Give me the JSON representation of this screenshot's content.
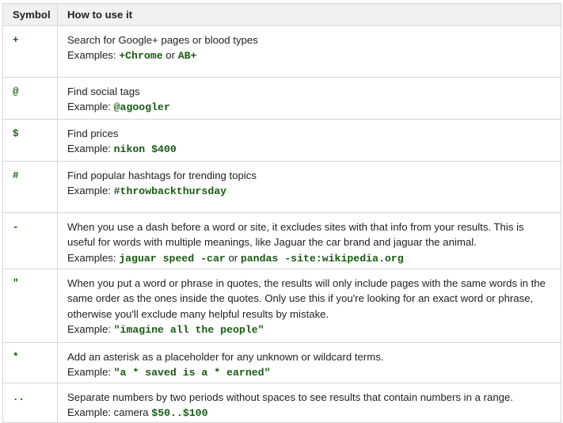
{
  "headers": {
    "symbol": "Symbol",
    "usage": "How to use it"
  },
  "rows": [
    {
      "symbol": "+",
      "text": "Search for Google+ pages or blood types",
      "example_prefix": "Examples: ",
      "ex1": "+Chrome",
      "joiner": " or ",
      "ex2": "AB+"
    },
    {
      "symbol": "@",
      "text": "Find social tags",
      "example_prefix": "Example: ",
      "ex1": "@agoogler"
    },
    {
      "symbol": "$",
      "text": "Find prices",
      "example_prefix": "Example: ",
      "ex1": "nikon $400"
    },
    {
      "symbol": "#",
      "text": "Find popular hashtags for trending topics",
      "example_prefix": "Example: ",
      "ex1": "#throwbackthursday"
    },
    {
      "symbol": "-",
      "text": "When you use a dash before a word or site, it excludes sites with that info from your results. This is useful for words with multiple meanings, like Jaguar the car brand and jaguar the animal.",
      "example_prefix": "Examples: ",
      "ex1": "jaguar speed -car",
      "joiner": " or ",
      "ex2": "pandas -site:wikipedia.org"
    },
    {
      "symbol": "\"",
      "text": "When you put a word or phrase in quotes, the results will only include pages with the same words in the same order as the ones inside the quotes. Only use this if you're looking for an exact word or phrase, otherwise you'll exclude many helpful results by mistake.",
      "example_prefix": "Example: ",
      "ex1": "\"imagine all the people\""
    },
    {
      "symbol": "*",
      "text": "Add an asterisk as a placeholder for any unknown or wildcard terms.",
      "example_prefix": "Example: ",
      "ex1": "\"a * saved is a * earned\""
    },
    {
      "symbol": "..",
      "text": "Separate numbers by two periods without spaces to see results that contain numbers in a range.",
      "example_prefix": "Example: camera ",
      "ex1": "$50..$100"
    }
  ]
}
